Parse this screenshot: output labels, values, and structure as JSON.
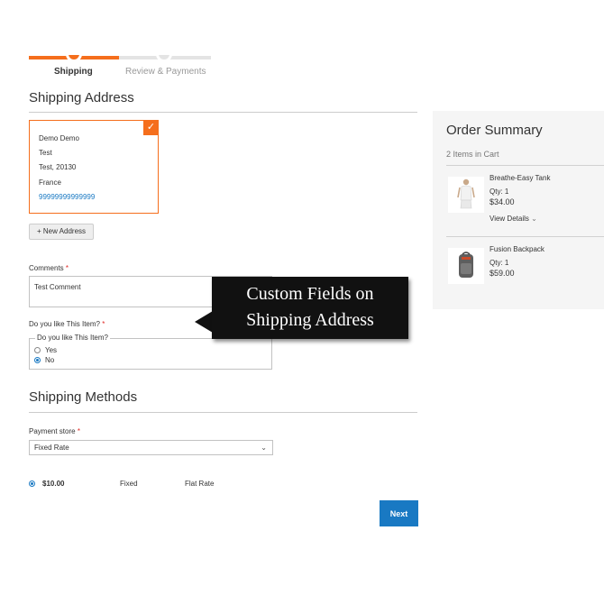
{
  "progress": {
    "steps": [
      {
        "label": "Shipping",
        "active": true
      },
      {
        "label": "Review & Payments",
        "active": false
      }
    ],
    "accent_color": "#f56e1c"
  },
  "shipping_address": {
    "title": "Shipping Address",
    "card": {
      "name": "Demo Demo",
      "street": "Test",
      "city_zip": "Test, 20130",
      "country": "France",
      "phone": "99999999999999",
      "selected": true
    },
    "new_address_label": "+ New Address"
  },
  "custom_fields": {
    "comments_label": "Comments",
    "comments_value": "Test Comment",
    "like_label": "Do you like This Item?",
    "like_legend": "Do you like This Item?",
    "options": [
      {
        "label": "Yes",
        "selected": false
      },
      {
        "label": "No",
        "selected": true
      }
    ],
    "required_mark": "*"
  },
  "callout": {
    "line1": "Custom Fields on",
    "line2": "Shipping Address"
  },
  "shipping_methods": {
    "title": "Shipping Methods",
    "payment_store_label": "Payment store",
    "payment_store_value": "Fixed Rate",
    "method": {
      "price": "$10.00",
      "method_title": "Fixed",
      "carrier_title": "Flat Rate",
      "selected": true
    },
    "next_label": "Next",
    "button_color": "#1979c3"
  },
  "order_summary": {
    "title": "Order Summary",
    "items_count": "2 Items in Cart",
    "items": [
      {
        "name": "Breathe-Easy Tank",
        "qty": "Qty: 1",
        "price": "$34.00",
        "details": "View Details",
        "icon": "tank-top-image"
      },
      {
        "name": "Fusion Backpack",
        "qty": "Qty: 1",
        "price": "$59.00",
        "icon": "backpack-image"
      }
    ]
  }
}
